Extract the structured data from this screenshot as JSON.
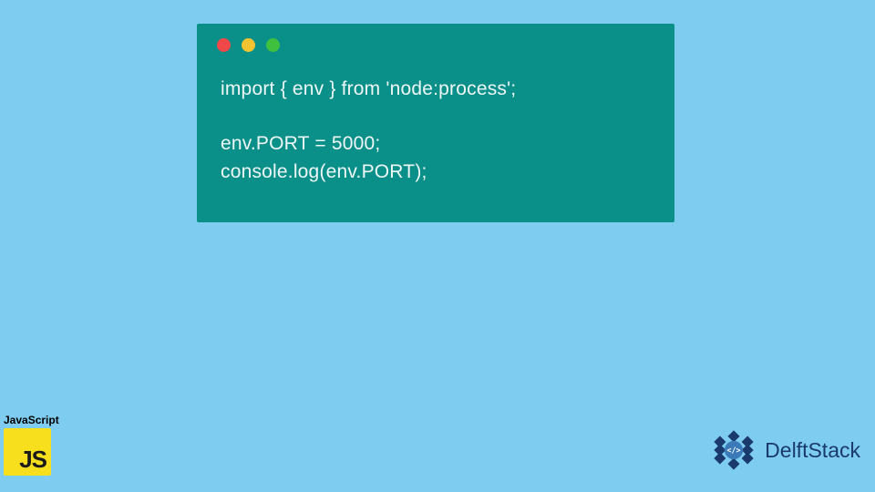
{
  "code": {
    "line1": "import { env } from 'node:process';",
    "line2": "env.PORT = 5000;",
    "line3": "console.log(env.PORT);"
  },
  "jsBadge": {
    "label": "JavaScript",
    "short": "JS"
  },
  "brand": {
    "name": "DelftStack"
  },
  "colors": {
    "bg": "#7ecdf0",
    "window": "#0b8f89",
    "dotRed": "#f04848",
    "dotYellow": "#f4c430",
    "dotGreen": "#3fc13f",
    "jsYellow": "#f7df1e",
    "brandBlue": "#1a3a6e"
  }
}
